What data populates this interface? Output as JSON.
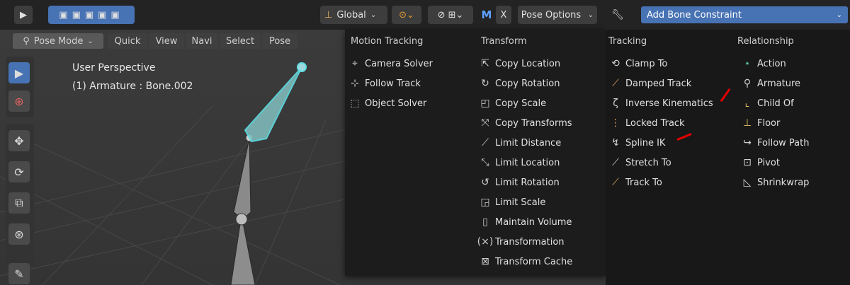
{
  "header": {
    "transform_orientation": "Global",
    "pose_options": "Pose Options",
    "x_label": "X",
    "m_label": "M"
  },
  "right_header": {
    "constraint_label": "Add Bone Constraint"
  },
  "mode_bar": {
    "mode": "Pose Mode",
    "menus": [
      "Quick",
      "View",
      "Navi",
      "Select",
      "Pose"
    ]
  },
  "viewport": {
    "perspective": "User Perspective",
    "object_info": "(1) Armature : Bone.002"
  },
  "menu": {
    "columns": [
      {
        "title": "Motion Tracking",
        "items": [
          {
            "label": "Camera Solver",
            "icon": "camera-solver-icon"
          },
          {
            "label": "Follow Track",
            "icon": "follow-track-icon"
          },
          {
            "label": "Object Solver",
            "icon": "object-solver-icon"
          }
        ]
      },
      {
        "title": "Transform",
        "items": [
          {
            "label": "Copy Location",
            "icon": "copy-location-icon"
          },
          {
            "label": "Copy Rotation",
            "icon": "copy-rotation-icon"
          },
          {
            "label": "Copy Scale",
            "icon": "copy-scale-icon"
          },
          {
            "label": "Copy Transforms",
            "icon": "copy-transforms-icon"
          },
          {
            "label": "Limit Distance",
            "icon": "limit-distance-icon"
          },
          {
            "label": "Limit Location",
            "icon": "limit-location-icon"
          },
          {
            "label": "Limit Rotation",
            "icon": "limit-rotation-icon"
          },
          {
            "label": "Limit Scale",
            "icon": "limit-scale-icon"
          },
          {
            "label": "Maintain Volume",
            "icon": "maintain-volume-icon"
          },
          {
            "label": "Transformation",
            "icon": "transformation-icon"
          },
          {
            "label": "Transform Cache",
            "icon": "transform-cache-icon"
          }
        ]
      },
      {
        "title": "Tracking",
        "items": [
          {
            "label": "Clamp To",
            "icon": "clamp-to-icon"
          },
          {
            "label": "Damped Track",
            "icon": "damped-track-icon"
          },
          {
            "label": "Inverse Kinematics",
            "icon": "inverse-kinematics-icon"
          },
          {
            "label": "Locked Track",
            "icon": "locked-track-icon"
          },
          {
            "label": "Spline IK",
            "icon": "spline-ik-icon"
          },
          {
            "label": "Stretch To",
            "icon": "stretch-to-icon"
          },
          {
            "label": "Track To",
            "icon": "track-to-icon"
          }
        ]
      },
      {
        "title": "Relationship",
        "items": [
          {
            "label": "Action",
            "icon": "action-icon"
          },
          {
            "label": "Armature",
            "icon": "armature-icon"
          },
          {
            "label": "Child Of",
            "icon": "child-of-icon"
          },
          {
            "label": "Floor",
            "icon": "floor-icon"
          },
          {
            "label": "Follow Path",
            "icon": "follow-path-icon"
          },
          {
            "label": "Pivot",
            "icon": "pivot-icon"
          },
          {
            "label": "Shrinkwrap",
            "icon": "shrinkwrap-icon"
          }
        ]
      }
    ]
  },
  "colors": {
    "accent": "#4772b3",
    "annotation_red": "#e00000",
    "bone_selected": "#5ee0e6"
  }
}
